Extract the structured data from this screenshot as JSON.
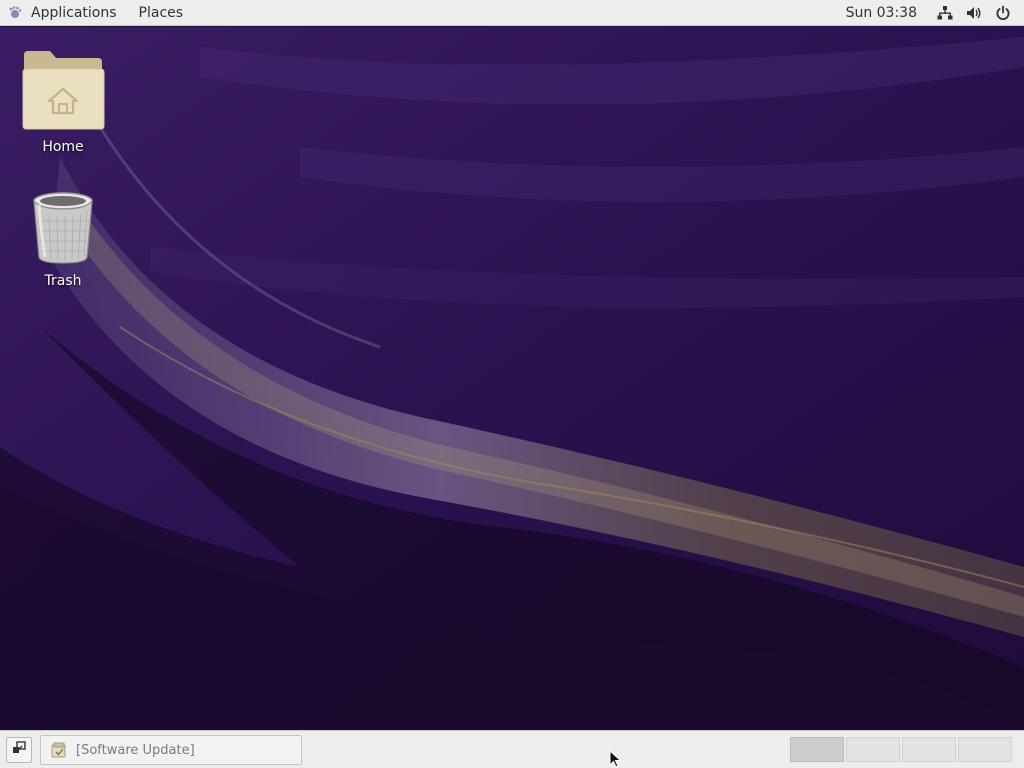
{
  "top_panel": {
    "applications_label": "Applications",
    "places_label": "Places",
    "clock": "Sun 03:38",
    "tray_icons": [
      "network-icon",
      "volume-icon",
      "power-icon"
    ]
  },
  "desktop": {
    "icons": [
      {
        "label": "Home",
        "icon": "folder-home-icon"
      },
      {
        "label": "Trash",
        "icon": "trash-icon"
      }
    ],
    "wallpaper_colors": {
      "base": "#2a1147",
      "light": "#4b3377",
      "gold": "#8a7a4a",
      "dark": "#1a0a2e"
    }
  },
  "bottom_panel": {
    "show_desktop_icon": "show-desktop-icon",
    "tasks": [
      {
        "label": "[Software Update]",
        "icon": "software-update-icon"
      }
    ],
    "workspaces": [
      {
        "active": true
      },
      {
        "active": false
      },
      {
        "active": false
      },
      {
        "active": false
      }
    ]
  }
}
